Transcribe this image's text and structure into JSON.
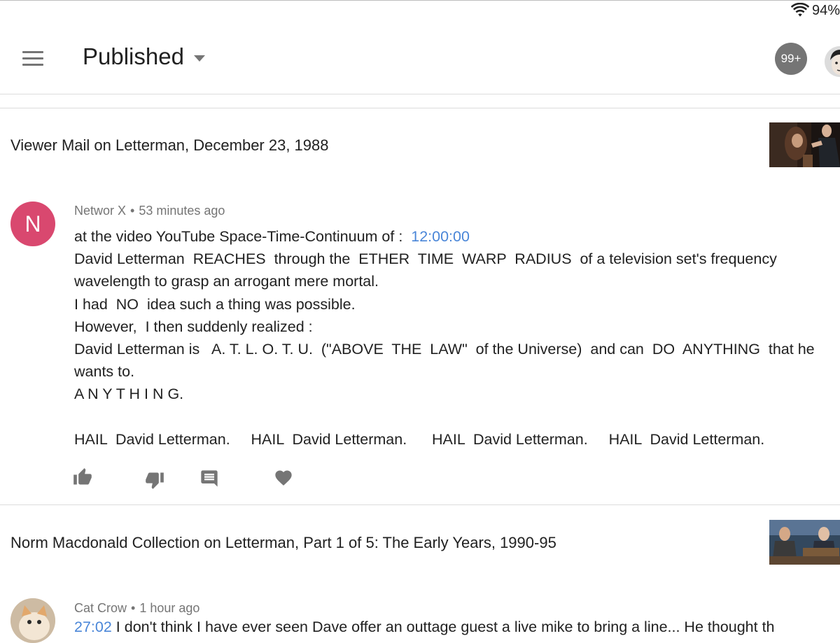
{
  "status": {
    "battery": "94%"
  },
  "header": {
    "title": "Published",
    "notification_count": "99+"
  },
  "items": [
    {
      "video_title": "Viewer Mail on Letterman, December 23, 1988"
    },
    {
      "video_title": "Norm Macdonald Collection on Letterman, Part 1 of 5: The Early Years, 1990-95"
    }
  ],
  "comment1": {
    "avatar_letter": "N",
    "author": "Networ X",
    "separator": "•",
    "time": "53 minutes ago",
    "line1_prefix": "at the video YouTube Space-Time-Continuum of :  ",
    "timestamp": "12:00:00",
    "body": "David Letterman  REACHES  through the  ETHER  TIME  WARP  RADIUS  of a television set's frequency\nwavelength to grasp an arrogant mere mortal.\nI had  NO  idea such a thing was possible.\nHowever,  I then suddenly realized :\nDavid Letterman is   A. T. L. O. T. U.  (\"ABOVE  THE  LAW\"  of the Universe)  and can  DO  ANYTHING  that he\nwants to.\nA N Y T H I N G.\n\nHAIL  David Letterman.     HAIL  David Letterman.      HAIL  David Letterman.     HAIL  David Letterman."
  },
  "comment2": {
    "author": "Cat Crow",
    "separator": "•",
    "time": "1 hour ago",
    "line1_timestamp": "27:02",
    "line1_text": " I don't think I have ever seen Dave offer an outtage guest a live mike to bring a line... He thought th"
  },
  "icons": {
    "menu": "hamburger-icon",
    "dropdown": "chevron-down-icon",
    "like": "thumbs-up-icon",
    "dislike": "thumbs-down-icon",
    "reply": "comment-icon",
    "heart": "heart-icon"
  },
  "colors": {
    "avatar_n": "#d9486f",
    "link": "#4a86d8",
    "icon": "#757575"
  }
}
